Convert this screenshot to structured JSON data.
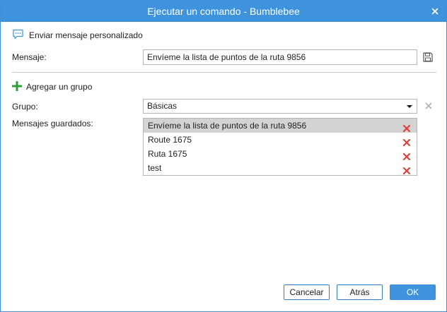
{
  "window": {
    "title": "Ejecutar un comando - Bumblebee"
  },
  "command": {
    "name": "Enviar mensaje personalizado",
    "icon": "chat-bubble-icon"
  },
  "message": {
    "label": "Mensaje:",
    "value": "Envíeme la lista de puntos de la ruta 9856"
  },
  "add_group": {
    "label": "Agregar un grupo"
  },
  "group": {
    "label": "Grupo:",
    "selected": "Básicas"
  },
  "saved_messages": {
    "label": "Mensajes guardados:",
    "items": [
      {
        "text": "Envíeme la lista de puntos de la ruta 9856",
        "selected": true
      },
      {
        "text": "Route 1675",
        "selected": false
      },
      {
        "text": "Ruta 1675",
        "selected": false
      },
      {
        "text": "test",
        "selected": false
      }
    ]
  },
  "buttons": {
    "cancel": "Cancelar",
    "back": "Atrás",
    "ok": "OK"
  },
  "colors": {
    "accent": "#3f92dc",
    "delete": "#e53935",
    "add": "#2e9e3e"
  }
}
